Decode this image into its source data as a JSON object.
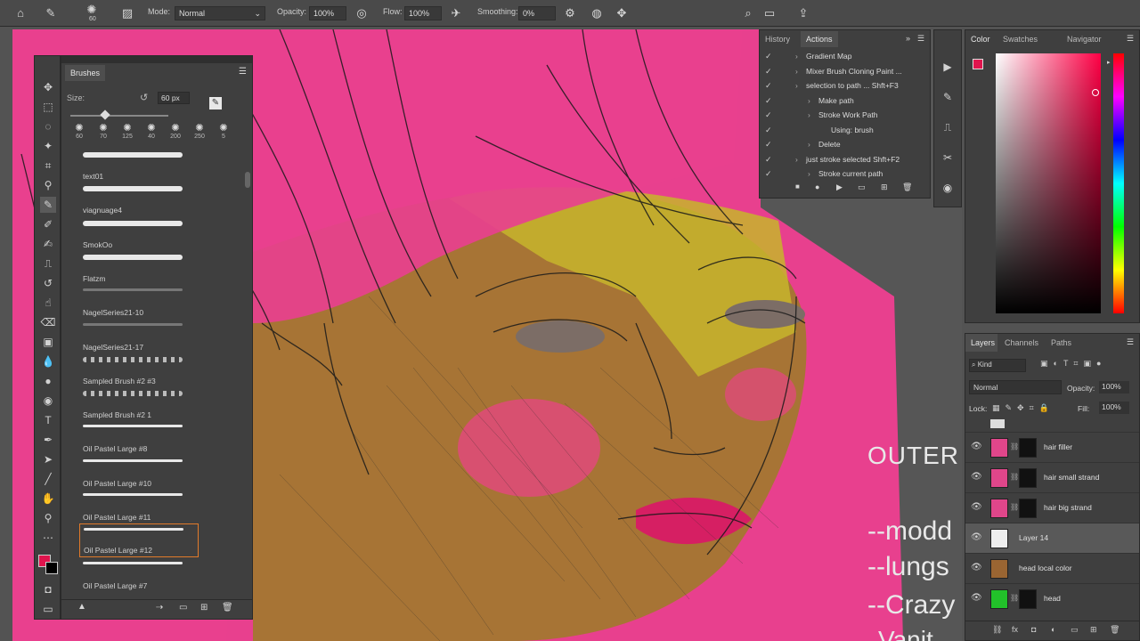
{
  "options_bar": {
    "brush_size": "60",
    "mode_label": "Mode:",
    "mode_value": "Normal",
    "opacity_label": "Opacity:",
    "opacity_value": "100%",
    "flow_label": "Flow:",
    "flow_value": "100%",
    "smoothing_label": "Smoothing:",
    "smoothing_value": "0%"
  },
  "brushes_panel": {
    "title": "Brushes",
    "size_label": "Size:",
    "size_value": "60 px",
    "presets": [
      "60",
      "70",
      "125",
      "40",
      "200",
      "250",
      "5"
    ],
    "items": [
      {
        "name": "text01"
      },
      {
        "name": "viagnuage4"
      },
      {
        "name": "SmokOo"
      },
      {
        "name": "Flatzm"
      },
      {
        "name": "NagelSeries21-10"
      },
      {
        "name": "NagelSeries21-17"
      },
      {
        "name": "Sampled Brush #2 #3"
      },
      {
        "name": "Sampled Brush #2 1"
      },
      {
        "name": "Oil Pastel Large #8"
      },
      {
        "name": "Oil Pastel Large #10"
      },
      {
        "name": "Oil Pastel Large #11"
      },
      {
        "name": "Oil Pastel Large #12"
      },
      {
        "name": "Oil Pastel Large #7"
      }
    ],
    "selected_item": "Oil Pastel Large #12"
  },
  "history_panel": {
    "tab_history": "History",
    "tab_actions": "Actions",
    "actions": [
      {
        "label": "Gradient Map",
        "indent": 1
      },
      {
        "label": "Mixer Brush Cloning Paint ...",
        "indent": 1
      },
      {
        "label": "selection to path ...  Shft+F3",
        "indent": 1
      },
      {
        "label": "Make path",
        "indent": 2
      },
      {
        "label": "Stroke Work Path",
        "indent": 2
      },
      {
        "label": "Using: brush",
        "indent": 3
      },
      {
        "label": "Delete",
        "indent": 2
      },
      {
        "label": "just stroke selected  Shft+F2",
        "indent": 1
      },
      {
        "label": "Stroke current path",
        "indent": 2
      }
    ]
  },
  "color_panel": {
    "tabs": [
      "Color",
      "Swatches",
      "Navigator"
    ],
    "foreground": "#e0144d",
    "background": "#000000"
  },
  "layers_panel": {
    "tabs": [
      "Layers",
      "Channels",
      "Paths"
    ],
    "filter_value": "Kind",
    "blend_mode": "Normal",
    "opacity_label": "Opacity:",
    "opacity_value": "100%",
    "lock_label": "Lock:",
    "fill_label": "Fill:",
    "fill_value": "100%",
    "layers": [
      {
        "name": "hair filler",
        "thumb": "#e0468a",
        "selected": false
      },
      {
        "name": "hair small strand",
        "thumb": "#e0468a",
        "selected": false
      },
      {
        "name": "hair big strand",
        "thumb": "#e0468a",
        "selected": false
      },
      {
        "name": "Layer 14",
        "thumb": "#eeeeee",
        "selected": true
      },
      {
        "name": "head local color",
        "thumb": "#9a6532",
        "selected": false
      },
      {
        "name": "head",
        "thumb": "#22c12a",
        "selected": false
      }
    ]
  },
  "canvas_text": {
    "outer": "OUTER",
    "line1": "--modd",
    "line2": "--lungs",
    "line3": "--Crazy",
    "line4": "Vanit"
  }
}
